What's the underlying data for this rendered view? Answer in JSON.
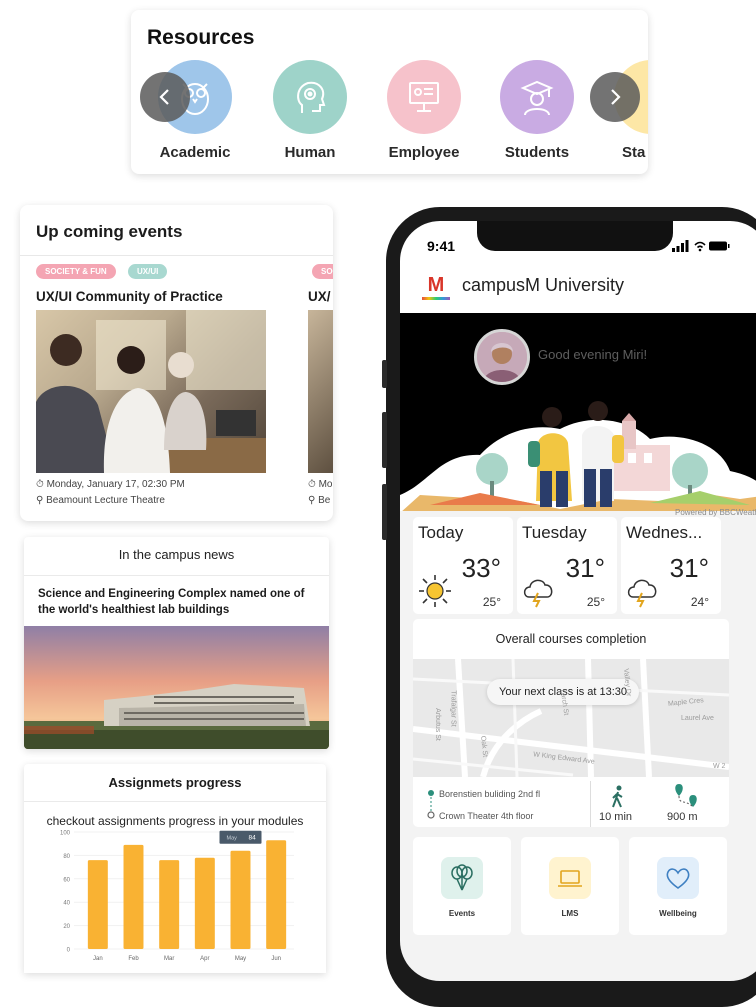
{
  "resources": {
    "title": "Resources",
    "items": [
      {
        "label": "Academic",
        "icon": "owl-icon",
        "color": "#9fc6ea"
      },
      {
        "label": "Human",
        "icon": "head-gear-icon",
        "color": "#9ed3c9"
      },
      {
        "label": "Employee",
        "icon": "presentation-icon",
        "color": "#f6c2cb"
      },
      {
        "label": "Students",
        "icon": "graduate-icon",
        "color": "#c9abe3"
      },
      {
        "label": "Sta",
        "icon": "staff-icon",
        "color": "#fde7a6"
      }
    ]
  },
  "events": {
    "title": "Up coming events",
    "cards": [
      {
        "tags": [
          "SOCIETY & FUN",
          "UX/UI"
        ],
        "title": "UX/UI Community of Practice",
        "date": "Monday, January 17,  02:30 PM",
        "location": "Beamount Lecture Theatre"
      },
      {
        "tags": [
          "SOC"
        ],
        "title": "UX/",
        "date": "Mo",
        "location": "Be"
      }
    ]
  },
  "news": {
    "title": "In the campus news",
    "headline": "Science and Engineering Complex named one of the world's healthiest lab buildings"
  },
  "assignments": {
    "title": "Assignmets progress",
    "subtitle": "checkout assignments progress in your modules",
    "tooltip": {
      "label": "May",
      "value": "84"
    }
  },
  "chart_data": {
    "type": "bar",
    "categories": [
      "Jan",
      "Feb",
      "Mar",
      "Apr",
      "May",
      "Jun"
    ],
    "values": [
      76,
      89,
      76,
      78,
      84,
      93
    ],
    "ylim": [
      0,
      100
    ],
    "yticks": [
      "0",
      "20",
      "40",
      "60",
      "80",
      "100"
    ],
    "bar_color": "#f9b233"
  },
  "phone": {
    "status_time": "9:41",
    "app_title": "campusM University",
    "greeting": "Good evening Miri!",
    "weather_credit": "Powered by BBCWeather",
    "weather": [
      {
        "day": "Today",
        "temp": "33°",
        "low": "25°",
        "icon": "sun-icon"
      },
      {
        "day": "Tuesday",
        "temp": "31°",
        "low": "25°",
        "icon": "storm-cloud-icon"
      },
      {
        "day": "Wednes...",
        "temp": "31°",
        "low": "24°",
        "icon": "storm-cloud-icon"
      }
    ],
    "courses": {
      "title": "Overall courses completion",
      "next_class": "Your next class is at 13:30",
      "streets": [
        "Arbutus St",
        "Trafalgar St",
        "Larch St",
        "W King Edward Ave",
        "Laurel Ave",
        "Valley Dr",
        "Maple Cres",
        "Oak St",
        "W 2"
      ],
      "from": "Borenstien buliding 2nd fl",
      "to": "Crown Theater 4th floor",
      "walk_time": "10 min",
      "distance": "900 m"
    },
    "tiles": [
      {
        "label": "Events",
        "icon": "balloons-icon",
        "color": "#dff1ec"
      },
      {
        "label": "LMS",
        "icon": "laptop-icon",
        "color": "#fff3cf"
      },
      {
        "label": "Wellbeing",
        "icon": "heart-icon",
        "color": "#e1eefa"
      }
    ]
  }
}
